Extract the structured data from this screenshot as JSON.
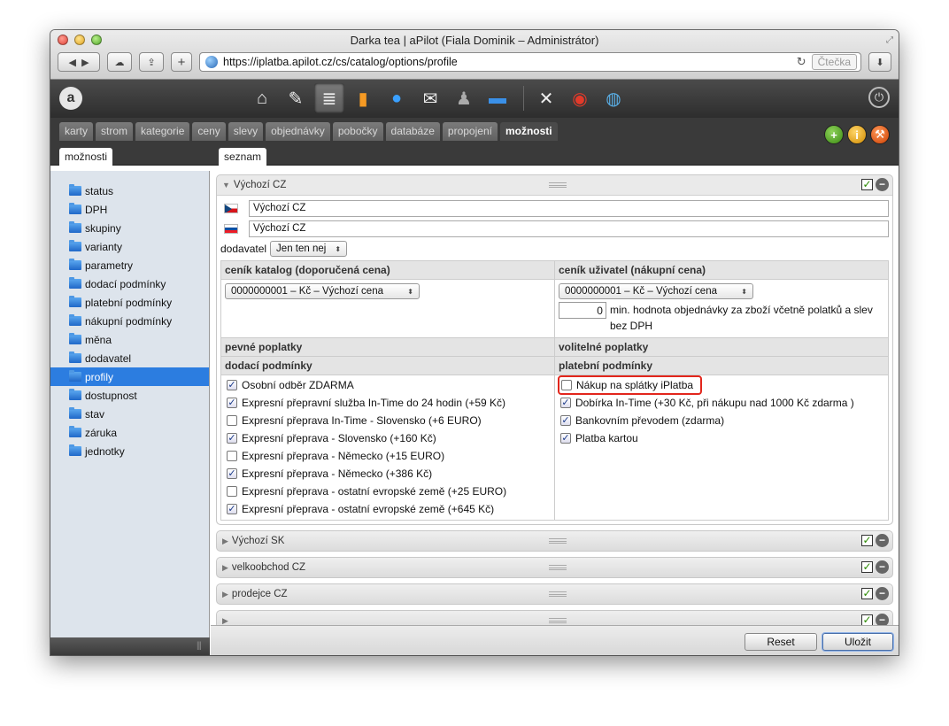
{
  "window": {
    "title": "Darka tea | aPilot (Fiala Dominik – Administrátor)",
    "url": "https://iplatba.apilot.cz/cs/catalog/options/profile",
    "reader_label": "Čtečka"
  },
  "toolbar_icons": [
    "home-icon",
    "document-icon",
    "database-icon",
    "chart-icon",
    "chat-icon",
    "mail-icon",
    "users-icon",
    "folder-icon",
    "tools-icon",
    "lifebuoy-icon",
    "globe-icon"
  ],
  "tabs": [
    "karty",
    "strom",
    "kategorie",
    "ceny",
    "slevy",
    "objednávky",
    "pobočky",
    "databáze",
    "propojení",
    "možnosti"
  ],
  "active_tab": "možnosti",
  "left_subtab": "možnosti",
  "right_subtab": "seznam",
  "sidebar": [
    "status",
    "DPH",
    "skupiny",
    "varianty",
    "parametry",
    "dodací podmínky",
    "platební podmínky",
    "nákupní podmínky",
    "měna",
    "dodavatel",
    "profily",
    "dostupnost",
    "stav",
    "záruka",
    "jednotky"
  ],
  "sidebar_selected": "profily",
  "profile": {
    "name": "Výchozí CZ",
    "name_cz": "Výchozí CZ",
    "name_sk": "Výchozí CZ",
    "supplier_label": "dodavatel",
    "supplier_value": "Jen ten nej",
    "catalog_header": "ceník katalog (doporučená cena)",
    "user_header": "ceník uživatel (nákupní cena)",
    "catalog_select": "0000000001 – Kč – Výchozí cena",
    "user_select": "0000000001 – Kč – Výchozí cena",
    "min_value": "0",
    "min_text": "min. hodnota objednávky za zboží včetně polatků a slev bez DPH",
    "fixed_fees": "pevné poplatky",
    "optional_fees": "volitelné poplatky",
    "delivery_header": "dodací podmínky",
    "payment_header": "platební podmínky",
    "delivery": [
      {
        "label": "Osobní odběr ZDARMA",
        "checked": true
      },
      {
        "label": "Expresní přepravní služba In-Time do 24 hodin (+59 Kč)",
        "checked": true
      },
      {
        "label": "Expresní přeprava In-Time - Slovensko (+6 EURO)",
        "checked": false
      },
      {
        "label": "Expresní přeprava - Slovensko (+160 Kč)",
        "checked": true
      },
      {
        "label": "Expresní přeprava - Německo (+15 EURO)",
        "checked": false
      },
      {
        "label": "Expresní přeprava - Německo (+386 Kč)",
        "checked": true
      },
      {
        "label": "Expresní přeprava - ostatní evropské země (+25 EURO)",
        "checked": false
      },
      {
        "label": "Expresní přeprava - ostatní evropské země (+645 Kč)",
        "checked": true
      }
    ],
    "payment": [
      {
        "label": "Nákup na splátky iPlatba",
        "checked": false,
        "highlight": true
      },
      {
        "label": "Dobírka In-Time (+30 Kč, při nákupu nad 1000 Kč zdarma )",
        "checked": true
      },
      {
        "label": "Bankovním převodem (zdarma)",
        "checked": true
      },
      {
        "label": "Platba kartou",
        "checked": true
      }
    ]
  },
  "collapsed_profiles": [
    "Výchozí SK",
    "velkoobchod CZ",
    "prodejce CZ"
  ],
  "buttons": {
    "reset": "Reset",
    "save": "Uložit"
  }
}
